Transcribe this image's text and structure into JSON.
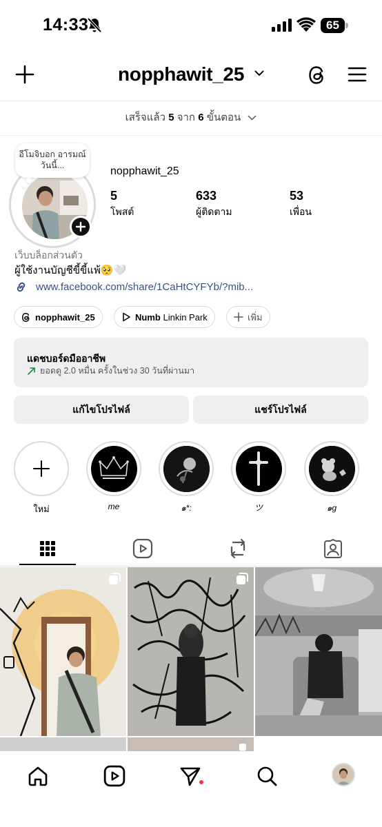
{
  "status_bar": {
    "time": "14:33",
    "battery": "65",
    "icons": [
      "bell-slash-icon",
      "signal-icon",
      "wifi-icon",
      "battery-icon"
    ]
  },
  "header": {
    "username": "nopphawit_25",
    "icons": [
      "plus-icon",
      "chevron-down-icon",
      "threads-icon",
      "menu-icon"
    ]
  },
  "progress": {
    "prefix": "เสร็จแล้ว",
    "done": "5",
    "mid": "จาก",
    "total": "6",
    "suffix": "ขั้นตอน"
  },
  "profile": {
    "note": "อีโมจิบอก อารมณ์วันนี้...",
    "name": "nopphawit_25",
    "stats": [
      {
        "value": "5",
        "label": "โพสต์"
      },
      {
        "value": "633",
        "label": "ผู้ติดตาม"
      },
      {
        "value": "53",
        "label": "เพื่อน"
      }
    ],
    "category": "เว็บบล็อกส่วนตัว",
    "bio": "ผู้ใช้งานบัญชีขี้ขี้แพ้🥺🤍",
    "link": "www.facebook.com/share/1CaHtCYFYb/?mib..."
  },
  "chips": {
    "threads": "nopphawit_25",
    "music_title": "Numb",
    "music_artist": "Linkin Park",
    "add": "เพิ่ม"
  },
  "dashboard": {
    "title": "แดชบอร์ดมืออาชีพ",
    "subtitle": "ยอดดู 2.0 หมื่น ครั้งในช่วง 30 วันที่ผ่านมา"
  },
  "buttons": {
    "edit": "แก้ไขโปรไฟล์",
    "share": "แชร์โปรไฟล์"
  },
  "highlights": [
    {
      "label": "ใหม่"
    },
    {
      "label": "me"
    },
    {
      "label": "๑*:"
    },
    {
      "label": "ツ"
    },
    {
      "label": "๑g"
    }
  ],
  "tabs": [
    "grid-icon",
    "reels-icon",
    "reposts-icon",
    "tagged-icon"
  ],
  "nav": [
    "home-icon",
    "reels-icon",
    "direct-icon",
    "search-icon",
    "profile-avatar"
  ],
  "colors": {
    "link": "#385185",
    "chip_border": "#dbdbdb",
    "button_bg": "#efeff1",
    "notification": "#ff3040",
    "trend": "#1a8a3a"
  }
}
